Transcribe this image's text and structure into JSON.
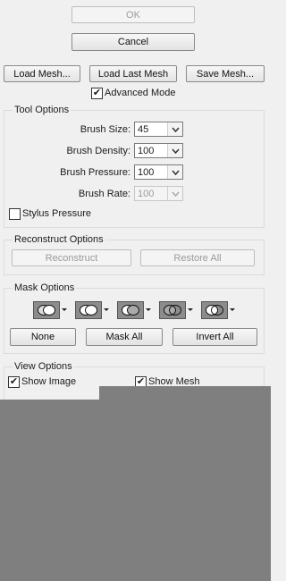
{
  "dialog": {
    "ok_label": "OK",
    "cancel_label": "Cancel",
    "load_mesh_label": "Load Mesh...",
    "load_last_mesh_label": "Load Last Mesh",
    "save_mesh_label": "Save Mesh...",
    "advanced_mode_label": "Advanced Mode",
    "advanced_mode_checked": true
  },
  "tool_options": {
    "title": "Tool Options",
    "brush_size": {
      "label": "Brush Size:",
      "value": "45"
    },
    "brush_density": {
      "label": "Brush Density:",
      "value": "100"
    },
    "brush_pressure": {
      "label": "Brush Pressure:",
      "value": "100"
    },
    "brush_rate": {
      "label": "Brush Rate:",
      "value": "100",
      "disabled": true
    },
    "stylus_pressure": {
      "label": "Stylus Pressure",
      "checked": false
    }
  },
  "reconstruct_options": {
    "title": "Reconstruct Options",
    "reconstruct_label": "Reconstruct",
    "restore_all_label": "Restore All"
  },
  "mask_options": {
    "title": "Mask Options",
    "mode_icons": [
      "replace-selection-icon",
      "add-to-selection-icon",
      "subtract-from-selection-icon",
      "intersect-with-selection-icon",
      "invert-selection-icon"
    ],
    "none_label": "None",
    "mask_all_label": "Mask All",
    "invert_all_label": "Invert All"
  },
  "view_options": {
    "title": "View Options",
    "show_image_label": "Show Image",
    "show_image_checked": true,
    "show_mesh_label": "Show Mesh",
    "show_mesh_checked": true
  },
  "colors": {
    "panel_bg": "#f0f0f0",
    "overlay_gray": "#7f7f7f"
  }
}
